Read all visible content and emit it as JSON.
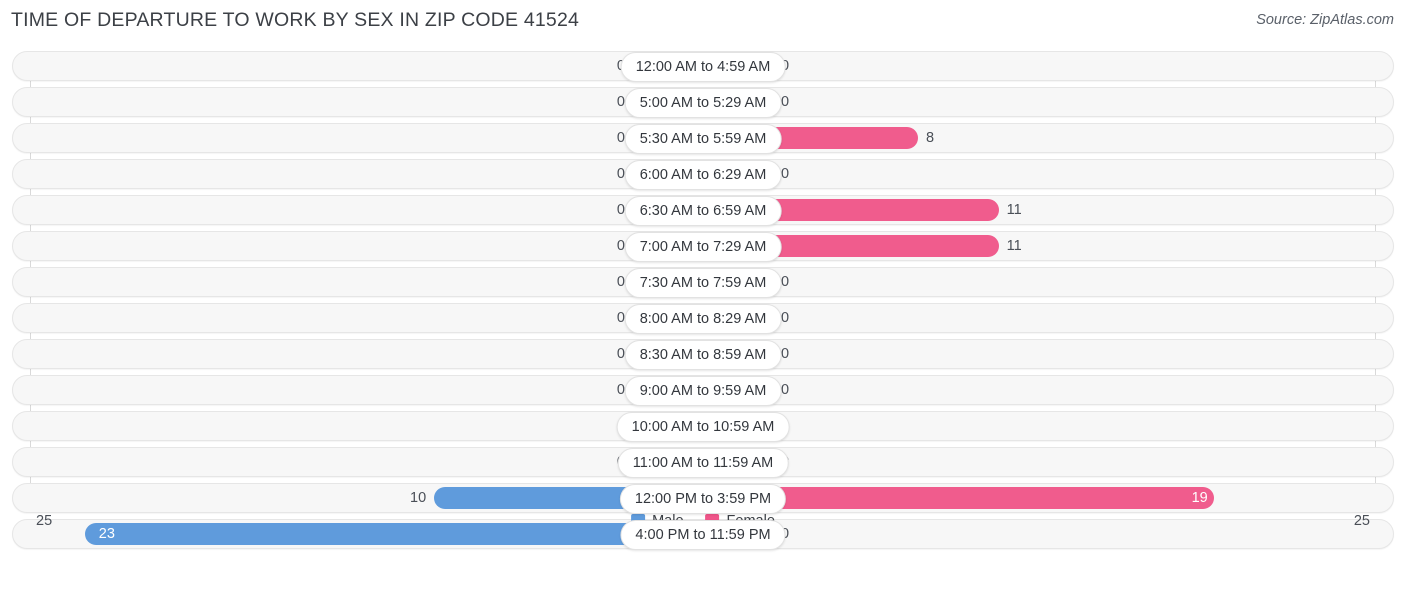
{
  "header": {
    "title": "TIME OF DEPARTURE TO WORK BY SEX IN ZIP CODE 41524",
    "source": "Source: ZipAtlas.com"
  },
  "legend": {
    "male_label": "Male",
    "female_label": "Female",
    "male_color": "#5f9bdc",
    "female_color": "#f0558a",
    "male_zero_color": "#aecbec",
    "female_zero_color": "#f9b4cc"
  },
  "axis": {
    "left_label": "25",
    "right_label": "25",
    "max": 25
  },
  "chart_data": {
    "type": "bar",
    "title": "TIME OF DEPARTURE TO WORK BY SEX IN ZIP CODE 41524",
    "xlabel": "",
    "ylabel": "",
    "orientation": "horizontal-diverging",
    "xlim": [
      25,
      25
    ],
    "grid": true,
    "legend_position": "bottom-center",
    "categories": [
      "12:00 AM to 4:59 AM",
      "5:00 AM to 5:29 AM",
      "5:30 AM to 5:59 AM",
      "6:00 AM to 6:29 AM",
      "6:30 AM to 6:59 AM",
      "7:00 AM to 7:29 AM",
      "7:30 AM to 7:59 AM",
      "8:00 AM to 8:29 AM",
      "8:30 AM to 8:59 AM",
      "9:00 AM to 9:59 AM",
      "10:00 AM to 10:59 AM",
      "11:00 AM to 11:59 AM",
      "12:00 PM to 3:59 PM",
      "4:00 PM to 11:59 PM"
    ],
    "series": [
      {
        "name": "Male",
        "values": [
          0,
          0,
          0,
          0,
          0,
          0,
          0,
          0,
          0,
          0,
          0,
          0,
          10,
          23
        ]
      },
      {
        "name": "Female",
        "values": [
          0,
          0,
          8,
          0,
          11,
          11,
          0,
          0,
          0,
          0,
          0,
          0,
          19,
          0
        ]
      }
    ]
  },
  "rows": [
    {
      "category": "12:00 AM to 4:59 AM",
      "male": "0",
      "female": "0"
    },
    {
      "category": "5:00 AM to 5:29 AM",
      "male": "0",
      "female": "0"
    },
    {
      "category": "5:30 AM to 5:59 AM",
      "male": "0",
      "female": "8"
    },
    {
      "category": "6:00 AM to 6:29 AM",
      "male": "0",
      "female": "0"
    },
    {
      "category": "6:30 AM to 6:59 AM",
      "male": "0",
      "female": "11"
    },
    {
      "category": "7:00 AM to 7:29 AM",
      "male": "0",
      "female": "11"
    },
    {
      "category": "7:30 AM to 7:59 AM",
      "male": "0",
      "female": "0"
    },
    {
      "category": "8:00 AM to 8:29 AM",
      "male": "0",
      "female": "0"
    },
    {
      "category": "8:30 AM to 8:59 AM",
      "male": "0",
      "female": "0"
    },
    {
      "category": "9:00 AM to 9:59 AM",
      "male": "0",
      "female": "0"
    },
    {
      "category": "10:00 AM to 10:59 AM",
      "male": "0",
      "female": "0"
    },
    {
      "category": "11:00 AM to 11:59 AM",
      "male": "0",
      "female": "0"
    },
    {
      "category": "12:00 PM to 3:59 PM",
      "male": "10",
      "female": "19"
    },
    {
      "category": "4:00 PM to 11:59 PM",
      "male": "23",
      "female": "0"
    }
  ]
}
